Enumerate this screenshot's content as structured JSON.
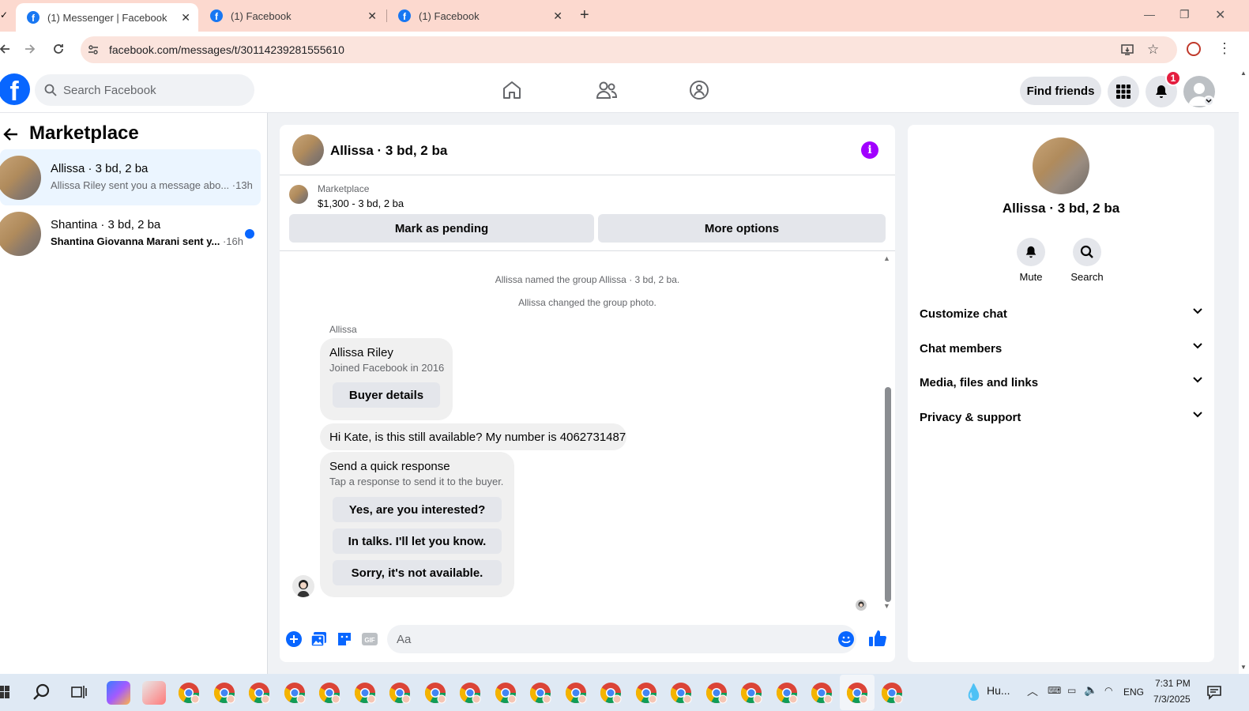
{
  "browser": {
    "tabs": [
      {
        "title": "(1) Messenger | Facebook",
        "active": true
      },
      {
        "title": "(1) Facebook",
        "active": false
      },
      {
        "title": "(1) Facebook",
        "active": false
      }
    ],
    "new_tab": "+",
    "url": "facebook.com/messages/t/30114239281555610"
  },
  "header": {
    "logo": "f",
    "search_placeholder": "Search Facebook",
    "find_friends": "Find friends",
    "notification_count": "1"
  },
  "sidebar": {
    "title": "Marketplace",
    "conversations": [
      {
        "name": "Allissa · 3 bd, 2 ba",
        "preview": "Allissa Riley sent you a message abo...",
        "time": "·13h",
        "selected": true,
        "unread": false
      },
      {
        "name": "Shantina · 3 bd, 2 ba",
        "preview": "Shantina Giovanna Marani sent y...",
        "time": "·16h",
        "selected": false,
        "unread": true
      }
    ]
  },
  "chat": {
    "title": "Allissa · 3 bd, 2 ba",
    "listing": {
      "category": "Marketplace",
      "price_title": "$1,300 - 3 bd, 2 ba"
    },
    "mark_pending": "Mark as pending",
    "more_options": "More options",
    "system_messages": [
      "Allissa named the group Allissa · 3 bd, 2 ba.",
      "Allissa changed the group photo."
    ],
    "sender_label": "Allissa",
    "buyer_card": {
      "name": "Allissa Riley",
      "joined": "Joined Facebook in 2016",
      "button": "Buyer details"
    },
    "message": "Hi Kate, is this still available? My number is 4062731487",
    "quick_response": {
      "title": "Send a quick response",
      "subtitle": "Tap a response to send it to the buyer.",
      "options": [
        "Yes, are you interested?",
        "In talks. I'll let you know.",
        "Sorry, it's not available."
      ]
    },
    "composer_placeholder": "Aa"
  },
  "details": {
    "name": "Allissa · 3 bd, 2 ba",
    "actions": [
      {
        "label": "Mute",
        "icon": "bell-icon"
      },
      {
        "label": "Search",
        "icon": "search-icon"
      }
    ],
    "sections": [
      "Customize chat",
      "Chat members",
      "Media, files and links",
      "Privacy & support"
    ]
  },
  "taskbar": {
    "weather": "Hu...",
    "language": "ENG",
    "time": "7:31 PM",
    "date": "7/3/2025"
  },
  "colors": {
    "fb_blue": "#0866ff",
    "info_purple": "#a100ff",
    "notification_red": "#e41e3f",
    "tab_bar": "#fcd9cf"
  }
}
